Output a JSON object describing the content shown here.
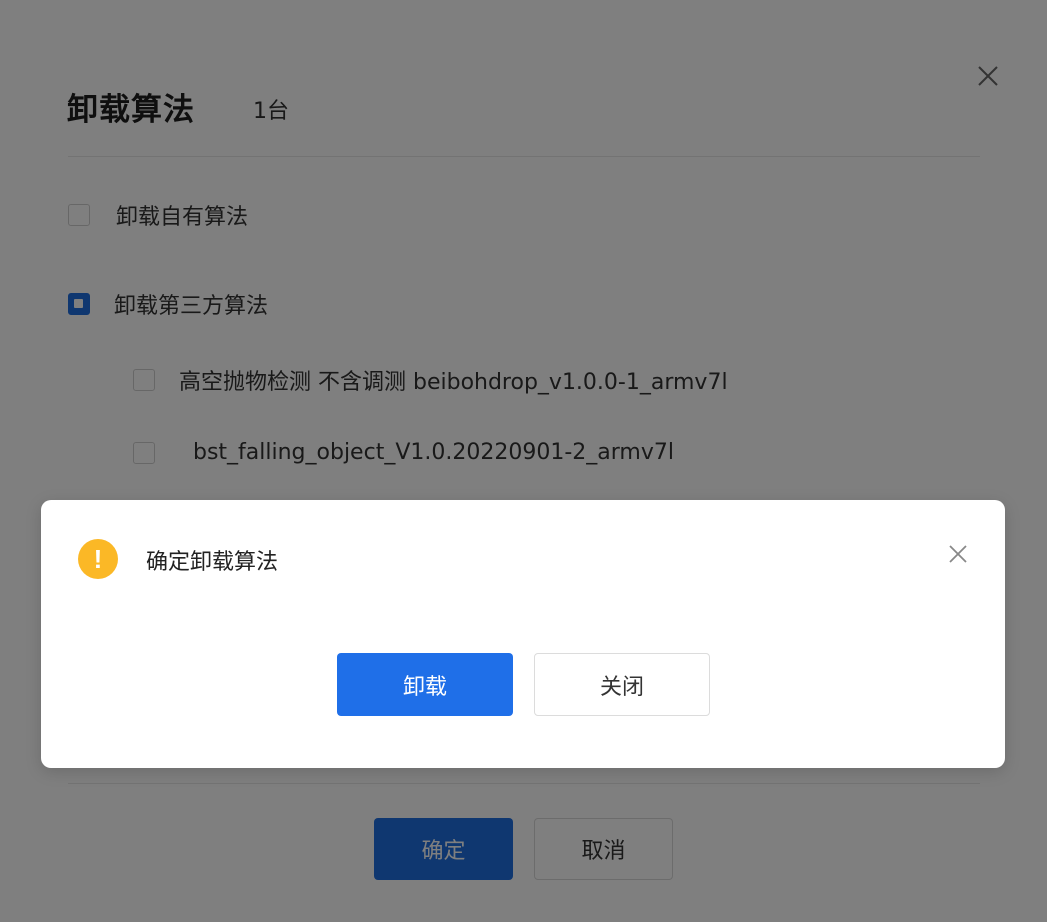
{
  "panel": {
    "title": "卸载算法",
    "count": "1台",
    "options": [
      {
        "label": "卸载自有算法",
        "state": "unchecked"
      },
      {
        "label": "卸载第三方算法",
        "state": "indeterminate"
      }
    ],
    "sub_options": [
      {
        "label": "高空抛物检测 不含调测  beibohdrop_v1.0.0-1_armv7l",
        "state": "unchecked"
      },
      {
        "label": "bst_falling_object_V1.0.20220901-2_armv7l",
        "state": "unchecked"
      }
    ],
    "footer": {
      "confirm_label": "确定",
      "cancel_label": "取消"
    }
  },
  "modal": {
    "icon": "warning-icon",
    "icon_glyph": "!",
    "title": "确定卸载算法",
    "primary_label": "卸载",
    "secondary_label": "关闭",
    "colors": {
      "primary": "#1f6fe8",
      "warning": "#fbb826"
    }
  }
}
